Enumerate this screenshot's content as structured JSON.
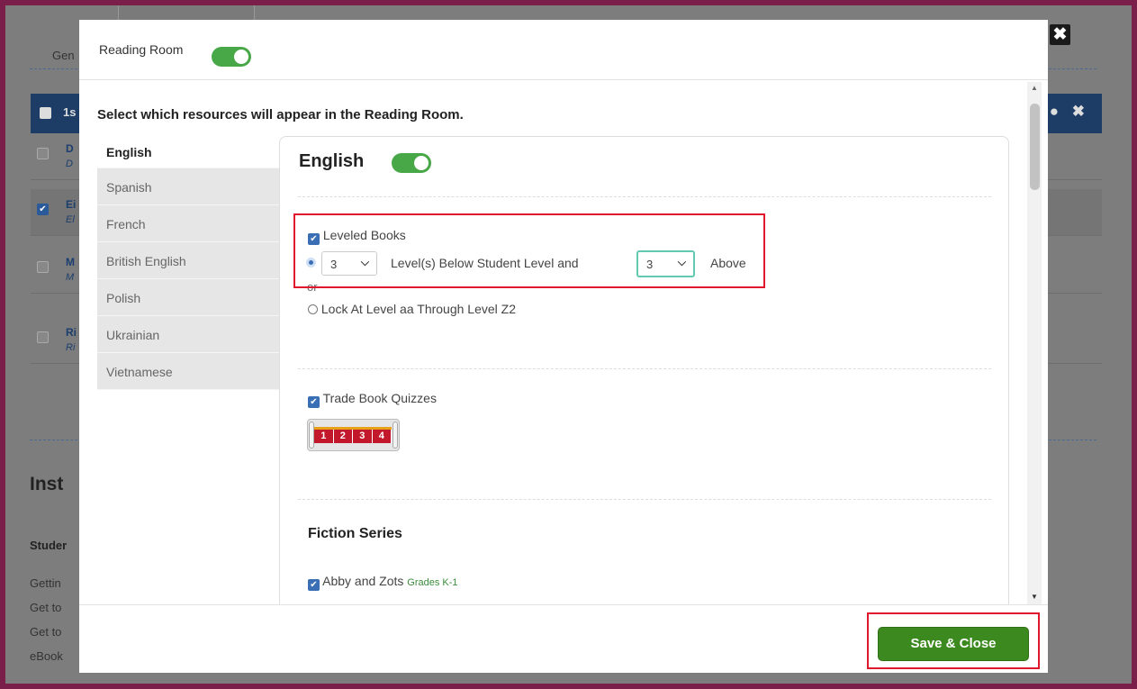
{
  "background": {
    "tab_label": "Gen",
    "header_text": "1s",
    "header_icons": "● ✖",
    "rows": [
      {
        "title": "D",
        "subtitle": "D",
        "checked": false
      },
      {
        "title": "Ei",
        "subtitle": "El",
        "checked": true
      },
      {
        "title": "M",
        "subtitle": "M",
        "checked": false
      },
      {
        "title": "Ri",
        "subtitle": "Ri",
        "checked": false
      }
    ],
    "inst_heading": "Inst",
    "student_heading": "Studer",
    "lines": [
      "Gettin",
      "Get to",
      "Get to",
      "eBook"
    ]
  },
  "modal": {
    "reading_room_label": "Reading Room",
    "reading_room_enabled": true,
    "select_heading": "Select which resources will appear in the Reading Room.",
    "languages": [
      "English",
      "Spanish",
      "French",
      "British English",
      "Polish",
      "Ukrainian",
      "Vietnamese"
    ],
    "active_language": "English",
    "panel": {
      "title": "English",
      "enabled": true,
      "leveled_books_label": "Leveled Books",
      "leveled_books_checked": true,
      "below_value": "3",
      "below_text": "Level(s) Below Student Level and",
      "above_value": "3",
      "above_text": "Above",
      "or_text": "or",
      "lock_text": "Lock At Level aa Through Level Z2",
      "trade_quizzes_label": "Trade Book Quizzes",
      "trade_quizzes_checked": true,
      "quiz_levels": [
        "1",
        "2",
        "3",
        "4"
      ],
      "fiction_heading": "Fiction Series",
      "series": [
        {
          "name": "Abby and Zots",
          "grades": "Grades K-1",
          "checked": true
        }
      ]
    },
    "save_label": "Save & Close",
    "close_glyph": "✖"
  },
  "colors": {
    "toggle_on": "#48a848",
    "save_button": "#3c8a1f",
    "annotation": "#e0182c",
    "highlight_select": "#63c9b0",
    "frame": "#7a1f4a"
  }
}
